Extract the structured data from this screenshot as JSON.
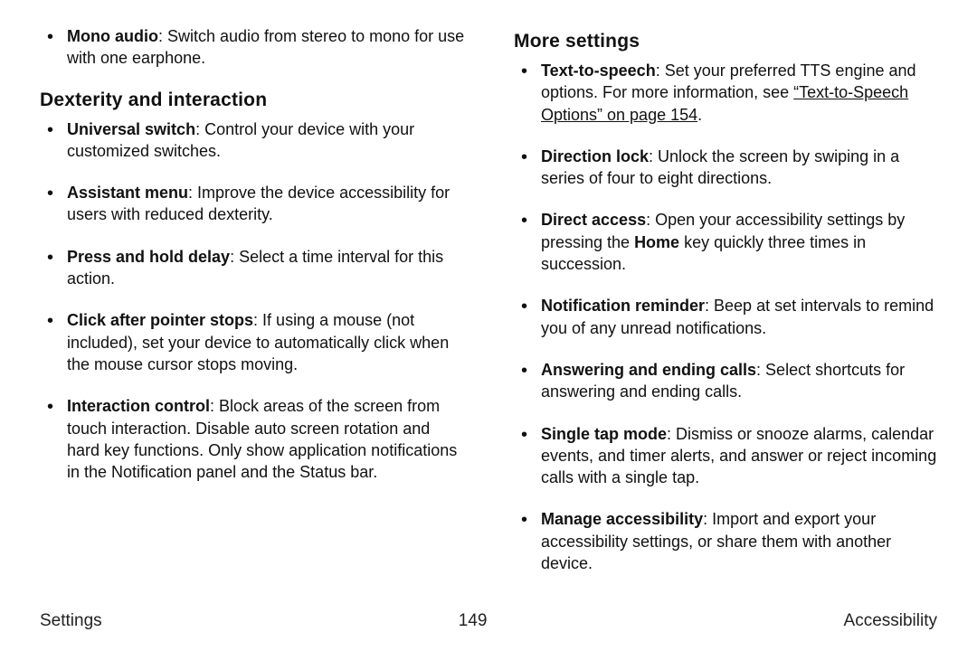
{
  "left": {
    "intro_item": {
      "bold": "Mono audio",
      "rest": ": Switch audio from stereo to mono for use with one earphone."
    },
    "section_title": "Dexterity and interaction",
    "items": [
      {
        "bold": "Universal switch",
        "rest": ": Control your device with your customized switches."
      },
      {
        "bold": "Assistant menu",
        "rest": ": Improve the device accessibility for users with reduced dexterity."
      },
      {
        "bold": "Press and hold delay",
        "rest": ": Select a time interval for this action."
      },
      {
        "bold": "Click after pointer stops",
        "rest": ": If using a mouse (not included), set your device to automatically click when the mouse cursor stops moving."
      },
      {
        "bold": "Interaction control",
        "rest": ": Block areas of the screen from touch interaction. Disable auto screen rotation and hard key functions. Only show application notifications in the Notification panel and the Status bar."
      }
    ]
  },
  "right": {
    "section_title": "More settings",
    "tts": {
      "bold": "Text-to-speech",
      "rest1": ": Set your preferred TTS engine and options. For more information, see ",
      "link": "“Text-to-Speech Options” on page 154",
      "rest2": "."
    },
    "items": [
      {
        "bold": "Direction lock",
        "rest": ": Unlock the screen by swiping in a series of four to eight directions."
      },
      {
        "bold": "Direct access",
        "pre": ": Open your accessibility settings by pressing the ",
        "bold2": "Home",
        "post": " key quickly three times in succession."
      },
      {
        "bold": "Notification reminder",
        "rest": ": Beep at set intervals to remind you of any unread notifications."
      },
      {
        "bold": "Answering and ending calls",
        "rest": ": Select shortcuts for answering and ending calls."
      },
      {
        "bold": "Single tap mode",
        "rest": ": Dismiss or snooze alarms, calendar events, and timer alerts, and answer or reject incoming calls with a single tap."
      },
      {
        "bold": "Manage accessibility",
        "rest": ": Import and export your accessibility settings, or share them with another device."
      }
    ]
  },
  "footer": {
    "left": "Settings",
    "center": "149",
    "right": "Accessibility"
  }
}
